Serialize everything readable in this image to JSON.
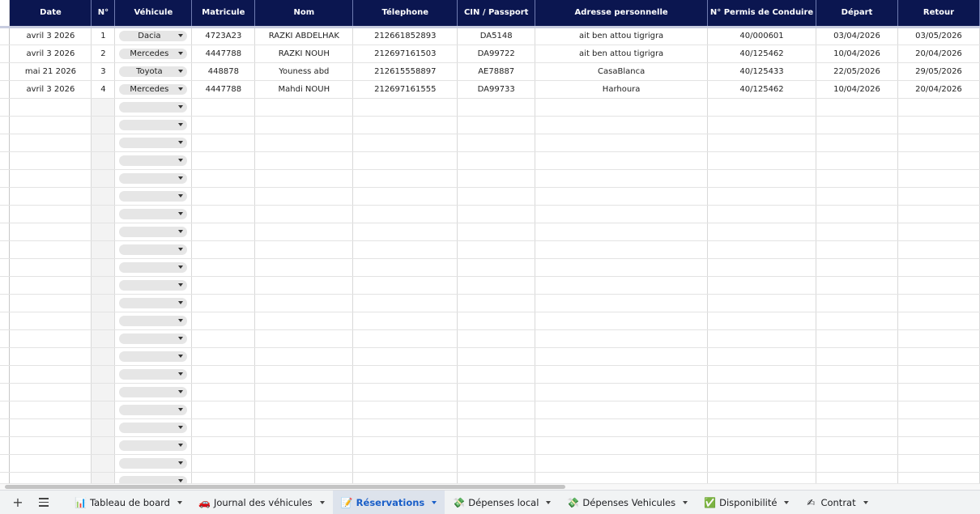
{
  "columns": [
    {
      "key": "date",
      "label": "Date"
    },
    {
      "key": "num",
      "label": "N°"
    },
    {
      "key": "vehicule",
      "label": "Véhicule"
    },
    {
      "key": "matricule",
      "label": "Matricule"
    },
    {
      "key": "nom",
      "label": "Nom"
    },
    {
      "key": "tel",
      "label": "Télephone"
    },
    {
      "key": "cin",
      "label": "CIN / Passport"
    },
    {
      "key": "adresse",
      "label": "Adresse personnelle"
    },
    {
      "key": "permis",
      "label": "N° Permis de Conduire"
    },
    {
      "key": "depart",
      "label": "Départ"
    },
    {
      "key": "retour",
      "label": "Retour"
    }
  ],
  "rows": [
    {
      "date": "avril 3 2026",
      "num": "1",
      "vehicule": "Dacia",
      "matricule": "4723A23",
      "nom": "RAZKI ABDELHAK",
      "tel": "212661852893",
      "cin": "DA5148",
      "adresse": "ait ben attou tigrigra",
      "permis": "40/000601",
      "depart": "03/04/2026",
      "retour": "03/05/2026"
    },
    {
      "date": "avril 3 2026",
      "num": "2",
      "vehicule": "Mercedes",
      "matricule": "4447788",
      "nom": "RAZKI NOUH",
      "tel": "212697161503",
      "cin": "DA99722",
      "adresse": "ait ben attou tigrigra",
      "permis": "40/125462",
      "depart": "10/04/2026",
      "retour": "20/04/2026"
    },
    {
      "date": "mai 21 2026",
      "num": "3",
      "vehicule": "Toyota",
      "matricule": "448878",
      "nom": "Youness abd",
      "tel": "212615558897",
      "cin": "AE78887",
      "adresse": "CasaBlanca",
      "permis": "40/125433",
      "depart": "22/05/2026",
      "retour": "29/05/2026"
    },
    {
      "date": "avril 3 2026",
      "num": "4",
      "vehicule": "Mercedes",
      "matricule": "4447788",
      "nom": "Mahdi NOUH",
      "tel": "212697161555",
      "cin": "DA99733",
      "adresse": "Harhoura",
      "permis": "40/125462",
      "depart": "10/04/2026",
      "retour": "20/04/2026"
    }
  ],
  "empty_row_count": 22,
  "tabbar": {
    "add_symbol": "+",
    "tabs": [
      {
        "name": "tableau",
        "label": "Tableau de board",
        "icon": "chart-icon",
        "glyph": "📊",
        "active": false
      },
      {
        "name": "journal",
        "label": "Journal des véhicules",
        "icon": "car-icon",
        "glyph": "🚗",
        "active": false
      },
      {
        "name": "reservations",
        "label": "Réservations",
        "icon": "memo-icon",
        "glyph": "📝",
        "active": true
      },
      {
        "name": "depenses-local",
        "label": "Dépenses local",
        "icon": "money-icon",
        "glyph": "💸",
        "active": false
      },
      {
        "name": "depenses-vehicules",
        "label": "Dépenses Vehicules",
        "icon": "money-icon",
        "glyph": "💸",
        "active": false
      },
      {
        "name": "disponibilite",
        "label": "Disponibilité",
        "icon": "check-box-icon",
        "glyph": "✅",
        "active": false
      },
      {
        "name": "contrat",
        "label": "Contrat",
        "icon": "signature-icon",
        "glyph": "✍",
        "active": false
      }
    ]
  },
  "colors": {
    "header_bg": "#0b1650",
    "active_tab": "#1a5fc8",
    "tabbar_bg": "#f1f3f4"
  }
}
